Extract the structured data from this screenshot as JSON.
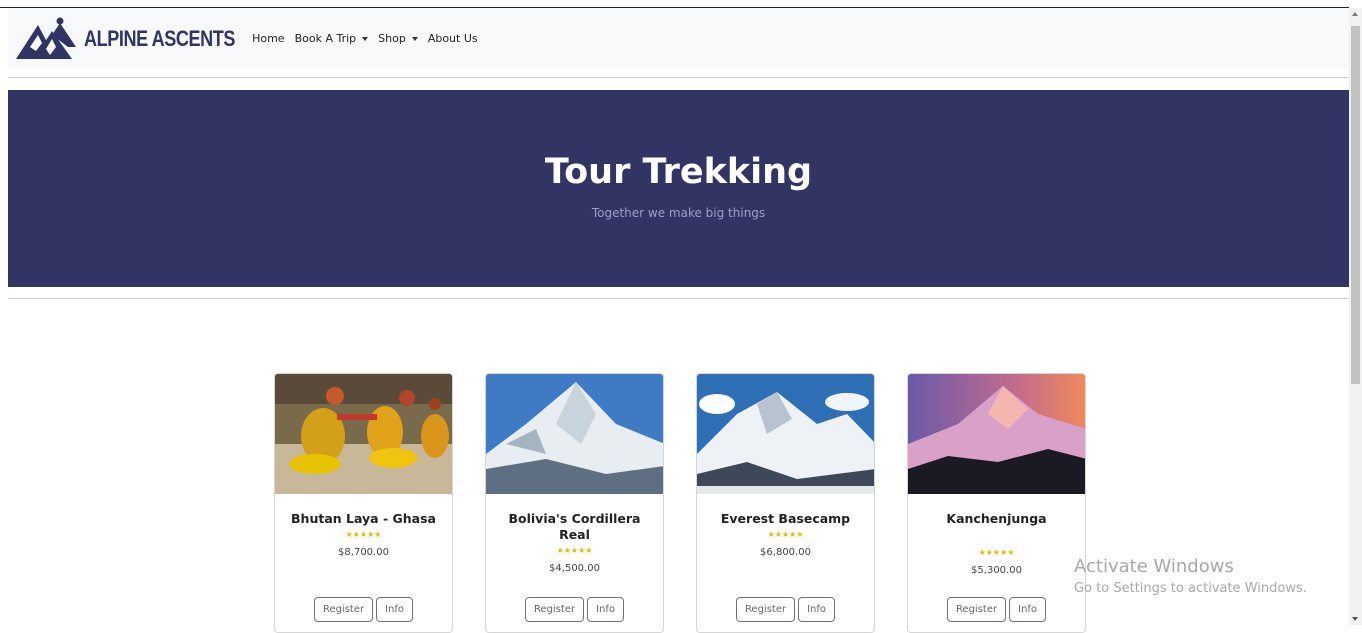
{
  "nav": {
    "brand": "ALPINE ASCENTS",
    "links": [
      {
        "label": "Home",
        "dropdown": false
      },
      {
        "label": "Book A Trip",
        "dropdown": true
      },
      {
        "label": "Shop",
        "dropdown": true
      },
      {
        "label": "About Us",
        "dropdown": false
      }
    ]
  },
  "hero": {
    "title": "Tour Trekking",
    "subtitle": "Together we make big things",
    "bg_color": "#323564"
  },
  "cards": [
    {
      "title": "Bhutan Laya - Ghasa",
      "stars": 5,
      "price": "$8,700.00",
      "register": "Register",
      "info": "Info"
    },
    {
      "title": "Bolivia's Cordillera Real",
      "stars": 5,
      "price": "$4,500.00",
      "register": "Register",
      "info": "Info"
    },
    {
      "title": "Everest Basecamp",
      "stars": 5,
      "price": "$6,800.00",
      "register": "Register",
      "info": "Info"
    },
    {
      "title": "Kanchenjunga",
      "stars": 5,
      "price": "$5,300.00",
      "register": "Register",
      "info": "Info"
    }
  ],
  "watermark": {
    "line1": "Activate Windows",
    "line2": "Go to Settings to activate Windows."
  }
}
